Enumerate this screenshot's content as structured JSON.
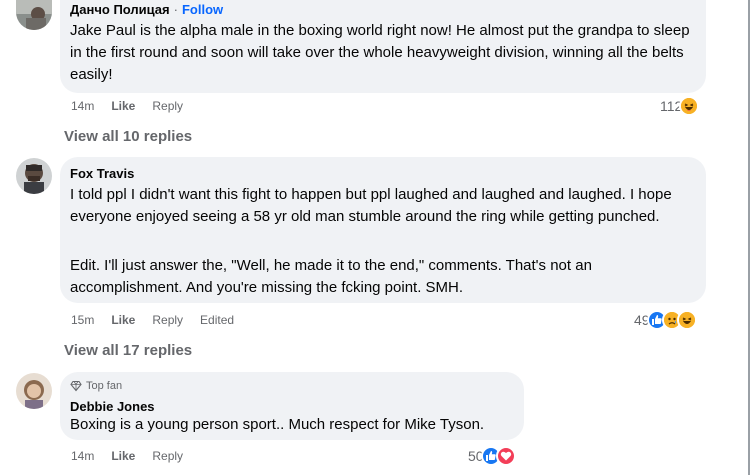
{
  "comments": [
    {
      "author": "Данчо Полицая",
      "follow_sep": "·",
      "follow_label": "Follow",
      "text": "Jake Paul is the alpha male in the boxing world right now! He almost put the grandpa to sleep in the first round and soon will take over the whole heavyweight division, winning all the belts easily!",
      "time": "14m",
      "like": "Like",
      "reply": "Reply",
      "reaction_count": "112",
      "reaction_icons": [
        "haha-icon"
      ],
      "view_replies": "View all 10 replies"
    },
    {
      "author": "Fox Travis",
      "text": "I told ppl I didn't want this fight to happen but ppl laughed and laughed and laughed. I hope everyone enjoyed seeing a 58 yr old man stumble around the ring while getting punched.",
      "text2": "Edit. I'll just answer the, \"Well, he made it to the end,\" comments. That's not an accomplishment. And you're missing the fcking point. SMH.",
      "time": "15m",
      "like": "Like",
      "reply": "Reply",
      "edited": "Edited",
      "reaction_count": "49",
      "reaction_icons": [
        "like-icon",
        "sad-icon",
        "haha-icon"
      ],
      "view_replies": "View all 17 replies"
    },
    {
      "badge": "Top fan",
      "author": "Debbie Jones",
      "text": "Boxing is a young person sport.. Much respect for Mike Tyson.",
      "time": "14m",
      "like": "Like",
      "reply": "Reply",
      "reaction_count": "50",
      "reaction_icons": [
        "like-icon",
        "love-icon"
      ]
    }
  ],
  "colors": {
    "bubble": "#f0f2f5",
    "secondary_text": "#65676b",
    "follow": "#0866ff",
    "like_blue": "#1877f2",
    "love_red": "#f33e58",
    "emoji_yellow": "#f7b125"
  }
}
